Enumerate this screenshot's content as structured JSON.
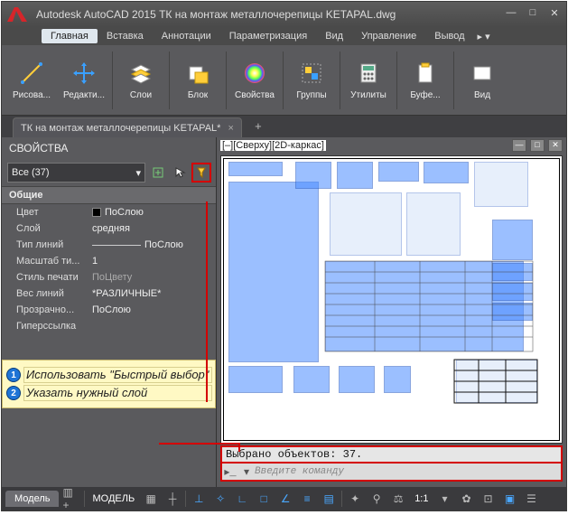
{
  "title": "Autodesk AutoCAD 2015    ТК на монтаж металлочерепицы KETAPAL.dwg",
  "menus": {
    "main": "Главная",
    "insert": "Вставка",
    "annot": "Аннотации",
    "param": "Параметризация",
    "view_m": "Вид",
    "manage": "Управление",
    "output": "Вывод"
  },
  "ribbon": {
    "draw": "Рисова...",
    "edit": "Редакти...",
    "layers": "Слои",
    "block": "Блок",
    "props": "Свойства",
    "groups": "Группы",
    "utils": "Утилиты",
    "bufer": "Буфе...",
    "view": "Вид"
  },
  "doc_tab": "ТК на монтаж металлочерепицы KETAPAL*",
  "properties": {
    "title": "СВОЙСТВА",
    "selection": "Все (37)",
    "section_general": "Общие",
    "rows": {
      "color_k": "Цвет",
      "color_v": "ПоСлою",
      "layer_k": "Слой",
      "layer_v": "средняя",
      "ltype_k": "Тип линий",
      "ltype_v": "ПоСлою",
      "ltscale_k": "Масштаб ти...",
      "ltscale_v": "1",
      "pstyle_k": "Стиль печати",
      "pstyle_v": "ПоЦвету",
      "lweight_k": "Вес линий",
      "lweight_v": "*РАЗЛИЧНЫЕ*",
      "transp_k": "Прозрачно...",
      "transp_v": "ПоСлою",
      "hlink_k": "Гиперссылка",
      "hlink_v": ""
    }
  },
  "notes": {
    "n1": "Использовать \"Быстрый выбор\"",
    "n2": "Указать нужный слой"
  },
  "viewport_label": "[–][Сверху][2D-каркас]",
  "cmd_status": "Выбрано объектов: 37.",
  "cmd_placeholder": "Введите команду",
  "status": {
    "model_tab": "Модель",
    "model_txt": "МОДЕЛЬ",
    "scale": "1:1"
  }
}
